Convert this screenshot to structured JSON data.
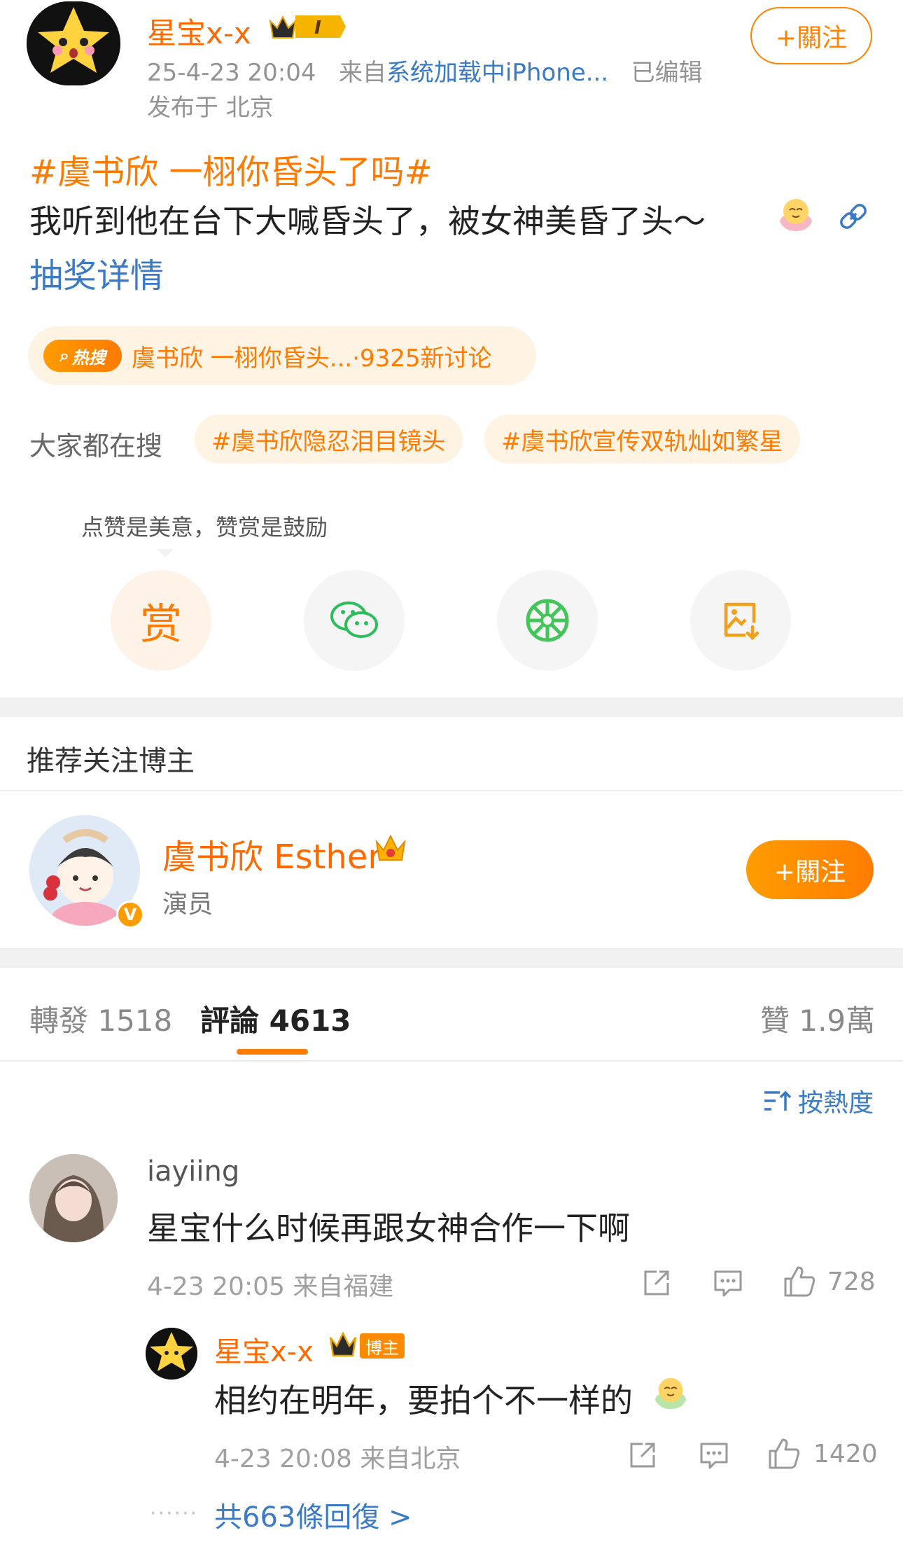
{
  "post": {
    "author": "星宝x-x",
    "level_badge": "I",
    "timestamp": "25-4-23 20:04",
    "source_prefix": "来自",
    "source": "系统加载中iPhone...",
    "edited": "已编辑",
    "location": "发布于 北京",
    "follow_label": "+關注",
    "hashtag": "#虞书欣 一栩你昏头了吗#",
    "text": "我听到他在台下大喊昏头了，被女神美昏了头～",
    "lottery_link": "抽奖详情"
  },
  "hot_search": {
    "badge": "热搜",
    "text": "虞书欣 一栩你昏头...·9325新讨论"
  },
  "searches": {
    "label": "大家都在搜",
    "tags": [
      "#虞书欣隐忍泪目镜头",
      "#虞书欣宣传双轨灿如繁星"
    ]
  },
  "reward": {
    "hint": "点赞是美意，赞赏是鼓励",
    "reward_char": "赏"
  },
  "recommend": {
    "title": "推荐关注博主",
    "name": "虞书欣 Esther",
    "role": "演员",
    "follow_label": "+關注"
  },
  "tabs": {
    "repost": "轉發 1518",
    "comments": "評論 4613",
    "likes": "贊 1.9萬"
  },
  "sort_label": "按熱度",
  "comment": {
    "user": "iayiing",
    "text": "星宝什么时候再跟女神合作一下啊",
    "meta": "4-23 20:05  来自福建",
    "likes": "728"
  },
  "reply": {
    "user": "星宝x-x",
    "badge": "博主",
    "text": "相约在明年，要拍个不一样的",
    "meta": "4-23 20:08  来自北京",
    "likes": "1420",
    "more": "共663條回復 >"
  },
  "colors": {
    "accent": "#ff8200",
    "link": "#3a7ac6"
  }
}
